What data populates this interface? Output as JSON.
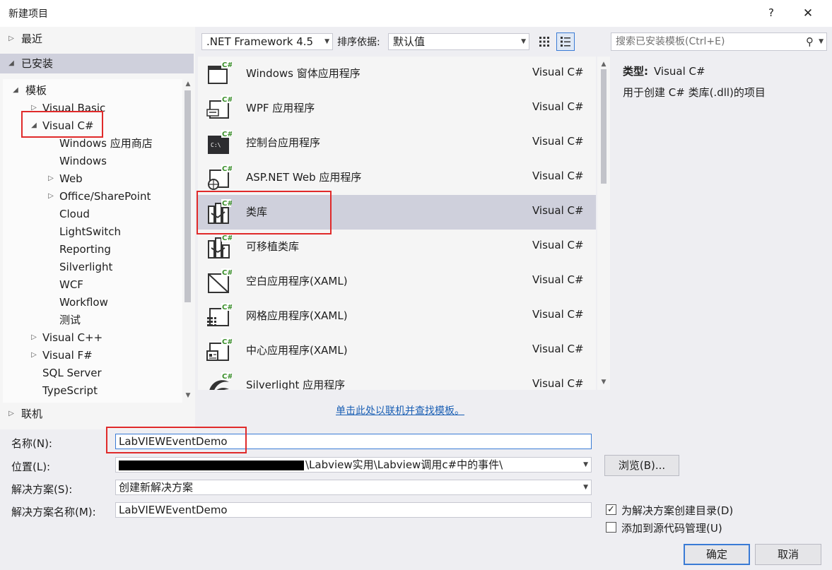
{
  "window": {
    "title": "新建项目",
    "help_glyph": "?",
    "close_glyph": "✕"
  },
  "tree": {
    "recent": "最近",
    "installed": "已安装",
    "templates": "模板",
    "visual_basic": "Visual Basic",
    "visual_csharp": "Visual C#",
    "csharp_children": [
      "Windows 应用商店",
      "Windows",
      "Web",
      "Office/SharePoint",
      "Cloud",
      "LightSwitch",
      "Reporting",
      "Silverlight",
      "WCF",
      "Workflow",
      "测试"
    ],
    "visual_cpp": "Visual C++",
    "visual_fsharp": "Visual F#",
    "sql_server": "SQL Server",
    "typescript": "TypeScript",
    "online": "联机"
  },
  "toolbar": {
    "framework": ".NET Framework 4.5",
    "sort_label": "排序依据:",
    "sort_value": "默认值"
  },
  "templates": [
    {
      "name": "Windows 窗体应用程序",
      "lang": "Visual C#",
      "icon": "winforms-icon"
    },
    {
      "name": "WPF 应用程序",
      "lang": "Visual C#",
      "icon": "wpf-icon"
    },
    {
      "name": "控制台应用程序",
      "lang": "Visual C#",
      "icon": "console-icon"
    },
    {
      "name": "ASP.NET Web 应用程序",
      "lang": "Visual C#",
      "icon": "web-icon"
    },
    {
      "name": "类库",
      "lang": "Visual C#",
      "icon": "class-library-icon"
    },
    {
      "name": "可移植类库",
      "lang": "Visual C#",
      "icon": "portable-library-icon"
    },
    {
      "name": "空白应用程序(XAML)",
      "lang": "Visual C#",
      "icon": "blank-app-icon"
    },
    {
      "name": "网格应用程序(XAML)",
      "lang": "Visual C#",
      "icon": "grid-app-icon"
    },
    {
      "name": "中心应用程序(XAML)",
      "lang": "Visual C#",
      "icon": "hub-app-icon"
    },
    {
      "name": "Silverlight 应用程序",
      "lang": "Visual C#",
      "icon": "silverlight-icon"
    }
  ],
  "online_link": "单击此处以联机并查找模板。",
  "search": {
    "placeholder": "搜索已安装模板(Ctrl+E)"
  },
  "description": {
    "type_label": "类型:",
    "type_value": "Visual C#",
    "text": "用于创建 C# 类库(.dll)的项目"
  },
  "form": {
    "name_label": "名称(N):",
    "name_value": "LabVIEWEventDemo",
    "location_label": "位置(L):",
    "location_value": "\\Labview实用\\Labview调用c#中的事件\\",
    "browse_button": "浏览(B)...",
    "solution_label": "解决方案(S):",
    "solution_value": "创建新解决方案",
    "solution_name_label": "解决方案名称(M):",
    "solution_name_value": "LabVIEWEventDemo",
    "create_dir_label": "为解决方案创建目录(D)",
    "create_dir_checked": true,
    "source_control_label": "添加到源代码管理(U)",
    "source_control_checked": false,
    "ok_button": "确定",
    "cancel_button": "取消"
  },
  "colors": {
    "selection": "#cfd0dc",
    "accent": "#3a7bd5",
    "highlight": "#e02a2a",
    "csharp_green": "#3a8f2a"
  }
}
